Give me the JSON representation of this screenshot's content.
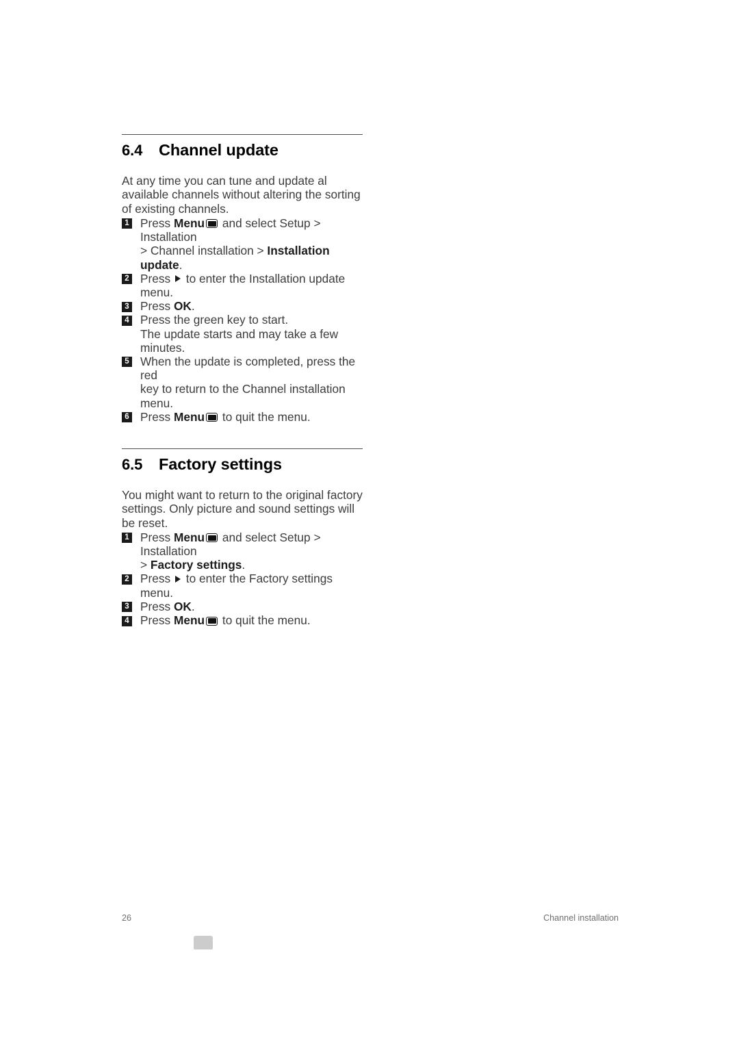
{
  "document": {
    "page_number": "26",
    "running_footer": "Channel installation"
  },
  "icons": {
    "menu": "menu-screen-icon",
    "right_arrow": "right-arrow-icon"
  },
  "sections": [
    {
      "number": "6.4",
      "title": "Channel update",
      "intro": "At any time you can tune and update al available channels without altering the sorting of existing channels.",
      "steps": [
        {
          "num": "1",
          "parts": [
            {
              "type": "text",
              "value": "Press "
            },
            {
              "type": "bold",
              "value": "Menu"
            },
            {
              "type": "icon",
              "value": "menu"
            },
            {
              "type": "text",
              "value": " and select Setup > Installation"
            }
          ],
          "continuation": [
            {
              "type": "text",
              "value": "> Channel installation > "
            },
            {
              "type": "bold",
              "value": "Installation update"
            },
            {
              "type": "text",
              "value": "."
            }
          ]
        },
        {
          "num": "2",
          "parts": [
            {
              "type": "text",
              "value": "Press "
            },
            {
              "type": "icon",
              "value": "right_arrow"
            },
            {
              "type": "text",
              "value": " to enter the Installation update menu."
            }
          ]
        },
        {
          "num": "3",
          "parts": [
            {
              "type": "text",
              "value": "Press "
            },
            {
              "type": "bold",
              "value": "OK"
            },
            {
              "type": "text",
              "value": "."
            }
          ]
        },
        {
          "num": "4",
          "parts": [
            {
              "type": "text",
              "value": "Press the green key to start."
            }
          ],
          "continuation": [
            {
              "type": "text",
              "value": "The update starts and may take a few minutes."
            }
          ]
        },
        {
          "num": "5",
          "parts": [
            {
              "type": "text",
              "value": "When the update is completed, press the red"
            }
          ],
          "continuation": [
            {
              "type": "text",
              "value": "key to return to the Channel installation menu."
            }
          ]
        },
        {
          "num": "6",
          "parts": [
            {
              "type": "text",
              "value": "Press "
            },
            {
              "type": "bold",
              "value": "Menu"
            },
            {
              "type": "icon",
              "value": "menu"
            },
            {
              "type": "text",
              "value": " to quit the menu."
            }
          ]
        }
      ]
    },
    {
      "number": "6.5",
      "title": "Factory settings",
      "intro": "You might want to return to the original factory settings. Only picture and sound settings will be reset.",
      "steps": [
        {
          "num": "1",
          "parts": [
            {
              "type": "text",
              "value": "Press "
            },
            {
              "type": "bold",
              "value": "Menu"
            },
            {
              "type": "icon",
              "value": "menu"
            },
            {
              "type": "text",
              "value": " and select Setup > Installation"
            }
          ],
          "continuation": [
            {
              "type": "text",
              "value": "> "
            },
            {
              "type": "bold",
              "value": "Factory settings"
            },
            {
              "type": "text",
              "value": "."
            }
          ]
        },
        {
          "num": "2",
          "parts": [
            {
              "type": "text",
              "value": "Press "
            },
            {
              "type": "icon",
              "value": "right_arrow"
            },
            {
              "type": "text",
              "value": " to enter the Factory settings menu."
            }
          ]
        },
        {
          "num": "3",
          "parts": [
            {
              "type": "text",
              "value": "Press "
            },
            {
              "type": "bold",
              "value": "OK"
            },
            {
              "type": "text",
              "value": "."
            }
          ]
        },
        {
          "num": "4",
          "parts": [
            {
              "type": "text",
              "value": "Press "
            },
            {
              "type": "bold",
              "value": "Menu"
            },
            {
              "type": "icon",
              "value": "menu"
            },
            {
              "type": "text",
              "value": " to quit the menu."
            }
          ]
        }
      ]
    }
  ]
}
